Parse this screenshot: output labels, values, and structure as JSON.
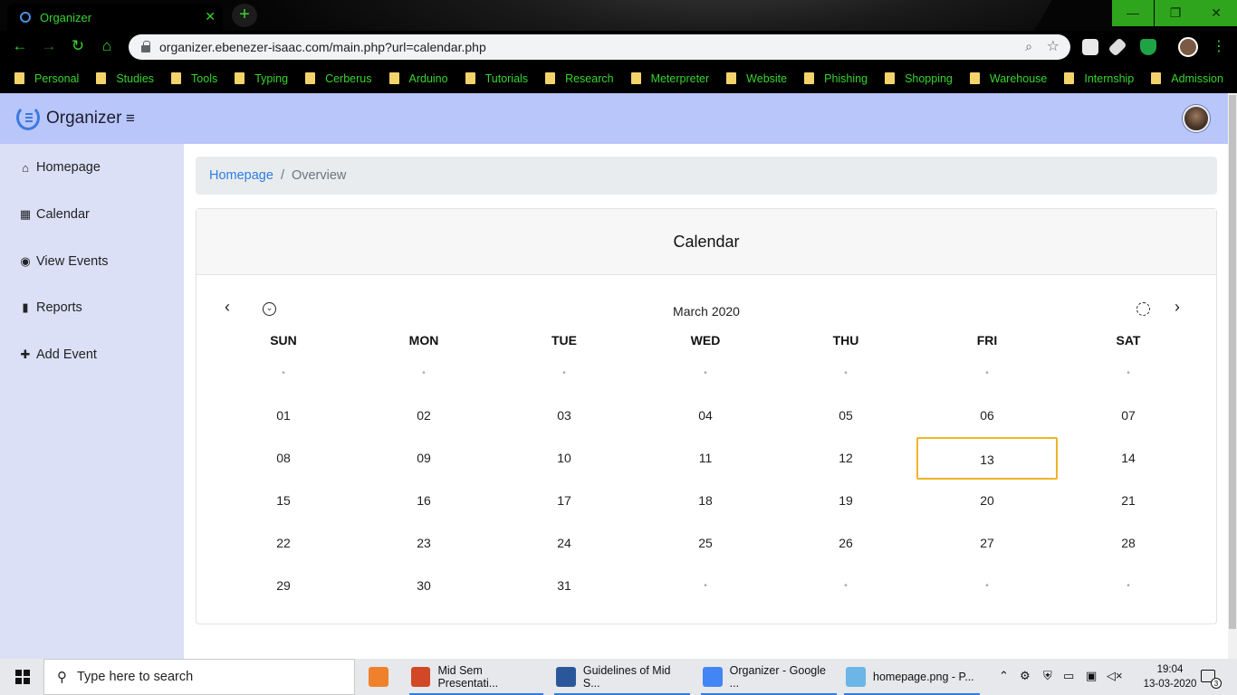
{
  "browser": {
    "tab_title": "Organizer",
    "tab_close": "✕",
    "new_tab": "+",
    "window_controls": {
      "minimize": "—",
      "maximize": "❐",
      "close": "✕"
    },
    "nav": {
      "back": "←",
      "forward": "→",
      "reload": "↻",
      "home": "⌂"
    },
    "url": "organizer.ebenezer-isaac.com/main.php?url=calendar.php",
    "bookmarks": [
      "Personal",
      "Studies",
      "Tools",
      "Typing",
      "Cerberus",
      "Arduino",
      "Tutorials",
      "Research",
      "Meterpreter",
      "Website",
      "Phishing",
      "Shopping",
      "Warehouse",
      "Internship",
      "Admission"
    ],
    "theme_color": "#38d430"
  },
  "app": {
    "brand": "Organizer",
    "menu_icon": "≡",
    "accent": "#2f7de1",
    "topnav_color": "#b9c6fa",
    "sidebar_color": "#dbe0f7"
  },
  "sidebar": {
    "items": [
      {
        "label": "Homepage",
        "icon": "home-icon",
        "glyph": "⌂"
      },
      {
        "label": "Calendar",
        "icon": "calendar-icon",
        "glyph": "▦"
      },
      {
        "label": "View Events",
        "icon": "eye-icon",
        "glyph": "◉"
      },
      {
        "label": "Reports",
        "icon": "bar-chart-icon",
        "glyph": "▮"
      },
      {
        "label": "Add Event",
        "icon": "plus-icon",
        "glyph": "✚"
      }
    ]
  },
  "breadcrumb": {
    "home": "Homepage",
    "separator": "/",
    "current": "Overview"
  },
  "calendar": {
    "title": "Calendar",
    "month_label": "March 2020",
    "prev": "‹",
    "next": "›",
    "picker_glyph": "⌄",
    "weekdays": [
      "SUN",
      "MON",
      "TUE",
      "WED",
      "THU",
      "FRI",
      "SAT"
    ],
    "empty_marker": "•",
    "weeks": [
      [
        "",
        "",
        "",
        "",
        "",
        "",
        ""
      ],
      [
        "01",
        "02",
        "03",
        "04",
        "05",
        "06",
        "07"
      ],
      [
        "08",
        "09",
        "10",
        "11",
        "12",
        "13",
        "14"
      ],
      [
        "15",
        "16",
        "17",
        "18",
        "19",
        "20",
        "21"
      ],
      [
        "22",
        "23",
        "24",
        "25",
        "26",
        "27",
        "28"
      ],
      [
        "29",
        "30",
        "31",
        "",
        "",
        "",
        ""
      ]
    ],
    "today": "13",
    "today_color": "#f0b429"
  },
  "taskbar": {
    "search_placeholder": "Type here to search",
    "apps": [
      {
        "label": "Mid Sem Presentati...",
        "icon": "powerpoint-icon",
        "color": "#d24726"
      },
      {
        "label": "Guidelines of Mid S...",
        "icon": "word-icon",
        "color": "#2b579a"
      },
      {
        "label": "Organizer - Google ...",
        "icon": "chrome-icon",
        "color": "#4285f4"
      },
      {
        "label": "homepage.png - P...",
        "icon": "paint-icon",
        "color": "#6bb6e6"
      }
    ],
    "time": "19:04",
    "date": "13-03-2020",
    "notification_count": "3"
  }
}
